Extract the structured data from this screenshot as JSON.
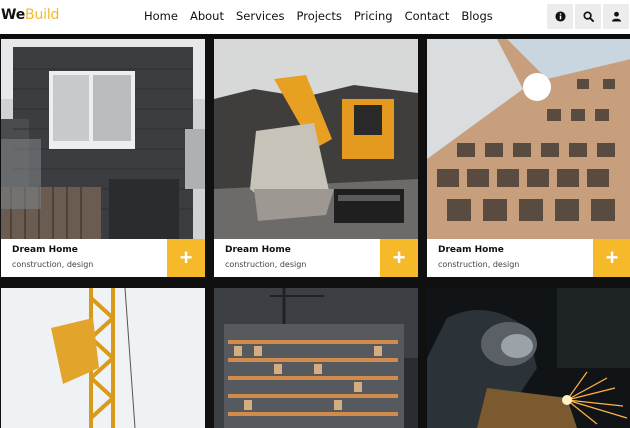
{
  "brand": {
    "part1": "We",
    "part2": "Build"
  },
  "nav": [
    "Home",
    "About",
    "Services",
    "Projects",
    "Pricing",
    "Contact",
    "Blogs"
  ],
  "icons": [
    "info-icon",
    "search-icon",
    "user-icon"
  ],
  "accent_color": "#f5b92a",
  "projects": [
    {
      "title": "Dream Home",
      "tags": "construction, design",
      "plus": "+"
    },
    {
      "title": "Dream Home",
      "tags": "construction, design",
      "plus": "+"
    },
    {
      "title": "Dream Home",
      "tags": "construction, design",
      "plus": "+"
    }
  ]
}
